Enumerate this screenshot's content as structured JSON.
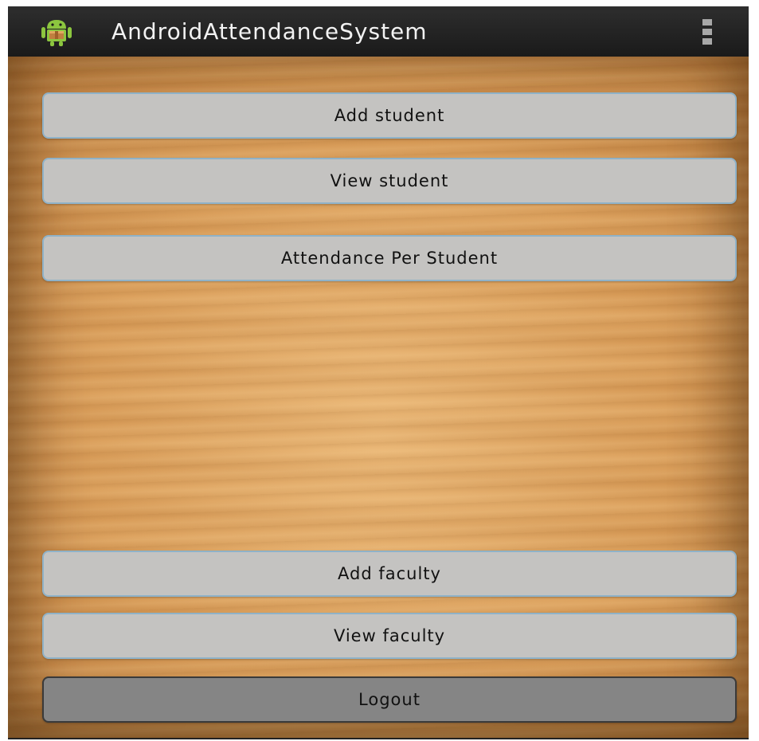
{
  "action_bar": {
    "title": "AndroidAttendanceSystem",
    "app_icon": "android-robot-icon",
    "overflow_icon": "overflow-menu-icon",
    "background_color": "#222222"
  },
  "buttons": {
    "add_student": "Add student",
    "view_student": "View student",
    "attendance_per_student": "Attendance Per Student",
    "add_faculty": "Add faculty",
    "view_faculty": "View faculty",
    "logout": "Logout"
  },
  "colors": {
    "button_fill": "#c4c3c1",
    "button_border": "#8fb2c8",
    "logout_fill": "#858585",
    "wood_background": "#d99c58"
  }
}
